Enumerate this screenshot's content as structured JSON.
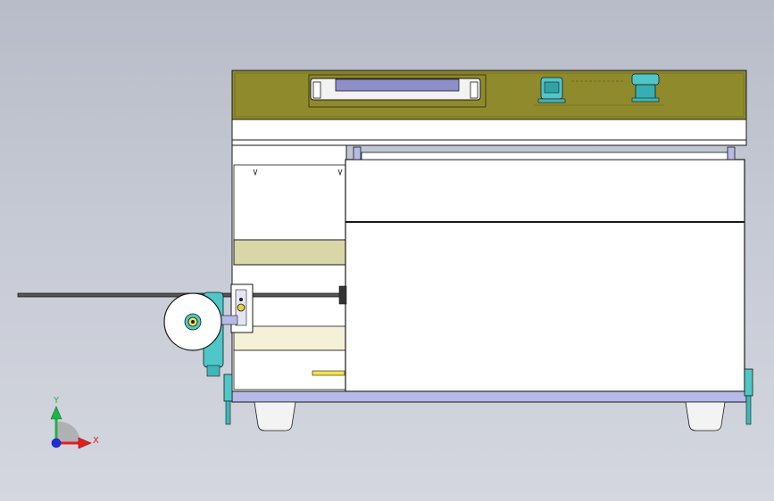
{
  "viewport": {
    "background": "#c2c6d0"
  },
  "colors": {
    "panel_olive": "#8f8a2b",
    "body_white": "#ffffff",
    "base_lavender": "#b7b9e6",
    "accent_cyan": "#4fc7c9",
    "tape_beige": "#d9d6a8",
    "cream": "#f4f1d6",
    "yellow_pin": "#f2e34a",
    "outline": "#1a1a1a"
  },
  "control_panel": {
    "display_text": "",
    "display_caption": "",
    "knob_left_icon": "selector-knob-icon",
    "knob_right_icon": "emergency-stop-icon"
  },
  "triad": {
    "x_label": "X",
    "y_label": "Y",
    "x_color": "#e0201e",
    "y_color": "#1fb34a",
    "z_color": "#1e2fd6"
  }
}
